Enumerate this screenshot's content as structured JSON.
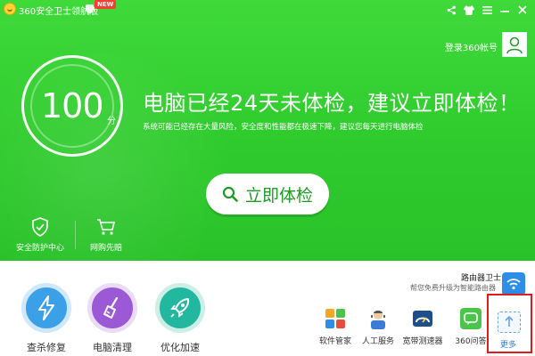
{
  "titlebar": {
    "app_title": "360安全卫士领航版",
    "new_badge": "NEW",
    "icons": [
      "share-icon",
      "shirt-icon",
      "menu-icon",
      "minimize-icon",
      "close-icon"
    ]
  },
  "account": {
    "login_label": "登录360帐号"
  },
  "score": {
    "value": "100",
    "unit": "分"
  },
  "headline": "电脑已经24天未体检，建议立即体检！",
  "subline": "系统可能已经存在大量风险，安全度和性能都在极速下降，建议您每天进行电脑体检",
  "check_button": {
    "label": "立即体检"
  },
  "left_tools": [
    {
      "label": "安全防护中心",
      "icon": "shield-check-icon"
    },
    {
      "label": "网购先赔",
      "icon": "shopping-cart-icon"
    }
  ],
  "main_tools": [
    {
      "label": "查杀修复",
      "icon": "lightning-icon",
      "color": "#3ca0e8"
    },
    {
      "label": "电脑清理",
      "icon": "broom-icon",
      "color": "#9b59d6"
    },
    {
      "label": "优化加速",
      "icon": "rocket-icon",
      "color": "#22b8a0"
    }
  ],
  "router": {
    "title": "路由器卫士",
    "subtitle": "帮您免费升级为智能路由器"
  },
  "mini_tools": [
    {
      "label": "软件管家",
      "icon": "software-manager-icon"
    },
    {
      "label": "人工服务",
      "icon": "support-person-icon"
    },
    {
      "label": "宽带测速器",
      "icon": "speed-test-icon"
    },
    {
      "label": "360问答",
      "icon": "qa-icon"
    }
  ],
  "more": {
    "label": "更多",
    "icon": "upload-arrow-icon"
  },
  "colors": {
    "brand_green": "#2fcb2d",
    "highlight_red": "#e01b1b",
    "button_text_green": "#1f9b25"
  }
}
